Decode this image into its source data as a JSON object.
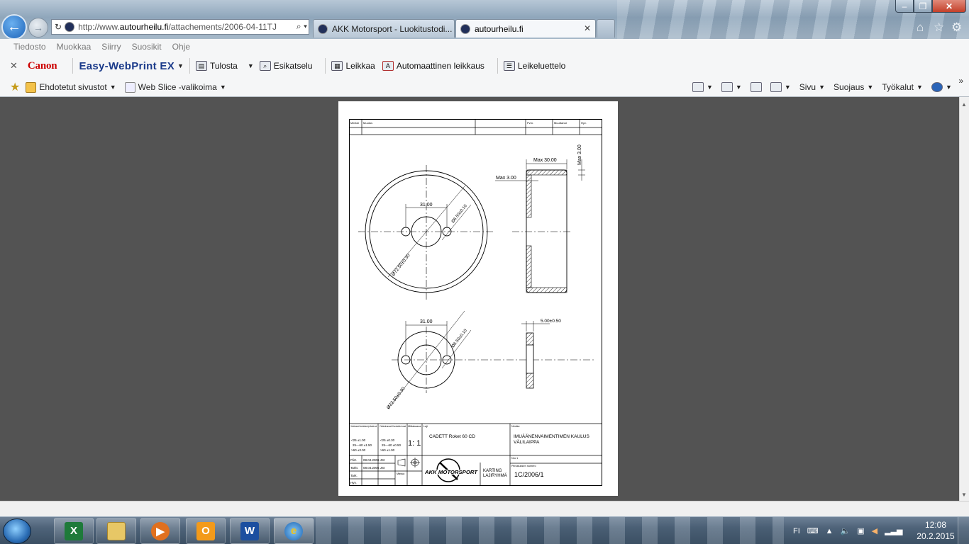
{
  "browser": {
    "url_prefix": "http://www.",
    "url_host": "autourheilu.fi",
    "url_path": "/attachements/2006-04-11TJ",
    "tabs": [
      {
        "label": "AKK Motorsport - Luokitustodi..."
      },
      {
        "label": "autourheilu.fi"
      }
    ],
    "menu": [
      "Tiedosto",
      "Muokkaa",
      "Siirry",
      "Suosikit",
      "Ohje"
    ],
    "canon_logo": "Canon",
    "easy_webprint": "Easy-WebPrint EX",
    "commands": {
      "print": "Tulosta",
      "preview": "Esikatselu",
      "clip": "Leikkaa",
      "auto_clip": "Automaattinen leikkaus",
      "clip_list": "Leikeluettelo"
    },
    "favorites": {
      "suggested": "Ehdotetut sivustot",
      "web_slice": "Web Slice -valikoima"
    },
    "tools": {
      "page": "Sivu",
      "safety": "Suojaus",
      "tools": "Työkalut"
    }
  },
  "drawing": {
    "header_fields": [
      "Merkki",
      "Muutos",
      "Pvm.",
      "Muuttanut",
      "Hyv."
    ],
    "dims": {
      "max_30": "Max  30.00",
      "max_3_left": "Max  3.00",
      "max_3_top": "Max  3.00",
      "d31_top": "31.00",
      "d65_top": "Ø6.50±0.10",
      "d72_top": "Ø72.50±0.30",
      "d31_bottom": "31.00",
      "d65_bottom": "Ø6.50±0.10",
      "d72_bottom": "Ø72.50±0.30",
      "thick": "5.00±0.50"
    },
    "titleblock": {
      "tolerance_header_1": "Yleistoleranssit Koneistettavat ja hitsatut osat",
      "tol_1": "<25 ±1.00",
      "tol_2": "25—60 ±1.50",
      "tol_3": ">60 ±3.00",
      "tolerance_header_2": "Yleistoleranssit Koneistetut osat",
      "tol_4": "<25 ±0.30",
      "tol_5": "25—60 ±0.50",
      "tol_6": ">60 ±1.00",
      "scale_header": "Mittakaava",
      "scale": "1: 1",
      "item_header": "Laji",
      "item": "CADETT  Roket  60  CD",
      "name_header": "Nimike",
      "name_line1": "IMUÄÄNENVAIMENTIMEN  KAULUS",
      "name_line2": "VÄLILAIPPA",
      "drawn_label": "Piirt.",
      "drawn_value": "08.04.2006  JSt",
      "checked_label": "Tarkt.",
      "checked_value": "08.04.2006  JSt",
      "approved_label": "Tark.",
      "accepted_label": "Hyv.",
      "mass_label": "Massa",
      "org_line1": "KARTING",
      "org_line2": "LAJIRYHMÄ",
      "sheet_label": "Nro  1",
      "drawing_no_header": "Piirustuksen numero",
      "drawing_no": "1C/2006/1",
      "logo_text": "AKK MOTORSPORT"
    }
  },
  "taskbar": {
    "lang": "FI",
    "time": "12:08",
    "date": "20.2.2015"
  }
}
